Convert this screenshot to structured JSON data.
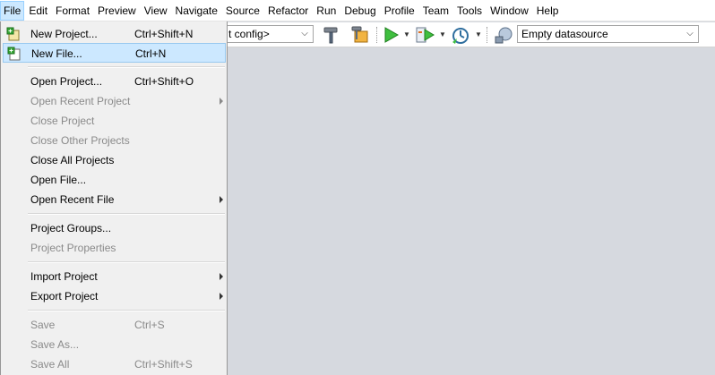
{
  "menubar": [
    "File",
    "Edit",
    "Format",
    "Preview",
    "View",
    "Navigate",
    "Source",
    "Refactor",
    "Run",
    "Debug",
    "Profile",
    "Team",
    "Tools",
    "Window",
    "Help"
  ],
  "toolbar": {
    "config_combo": "t config>",
    "datasource_combo": "Empty datasource"
  },
  "file_menu": {
    "items": [
      {
        "label": "New Project...",
        "accel": "Ctrl+Shift+N"
      },
      {
        "label": "New File...",
        "accel": "Ctrl+N"
      },
      {
        "label": "Open Project...",
        "accel": "Ctrl+Shift+O"
      },
      {
        "label": "Open Recent Project",
        "accel": ""
      },
      {
        "label": "Close Project",
        "accel": ""
      },
      {
        "label": "Close Other Projects",
        "accel": ""
      },
      {
        "label": "Close All Projects",
        "accel": ""
      },
      {
        "label": "Open File...",
        "accel": ""
      },
      {
        "label": "Open Recent File",
        "accel": ""
      },
      {
        "label": "Project Groups...",
        "accel": ""
      },
      {
        "label": "Project Properties",
        "accel": ""
      },
      {
        "label": "Import Project",
        "accel": ""
      },
      {
        "label": "Export Project",
        "accel": ""
      },
      {
        "label": "Save",
        "accel": "Ctrl+S"
      },
      {
        "label": "Save As...",
        "accel": ""
      },
      {
        "label": "Save All",
        "accel": "Ctrl+Shift+S"
      }
    ]
  },
  "colors": {
    "highlight": "#cce8ff",
    "background": "#d6d9df",
    "disabled_text": "#8a8a8a"
  }
}
